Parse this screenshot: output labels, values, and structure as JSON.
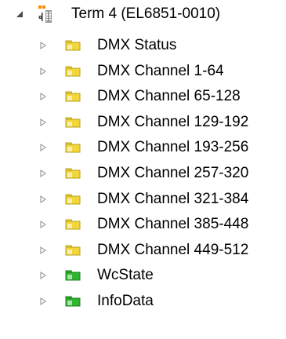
{
  "tree": {
    "root": {
      "label": "Term 4 (EL6851-0010)",
      "icon": "terminal-module-icon",
      "expanded": true
    },
    "children": [
      {
        "label": "DMX Status",
        "icon": "yellow-folder-icon",
        "color": "#f2d63a"
      },
      {
        "label": "DMX Channel 1-64",
        "icon": "yellow-folder-icon",
        "color": "#f2d63a"
      },
      {
        "label": "DMX Channel 65-128",
        "icon": "yellow-folder-icon",
        "color": "#f2d63a"
      },
      {
        "label": "DMX Channel 129-192",
        "icon": "yellow-folder-icon",
        "color": "#f2d63a"
      },
      {
        "label": "DMX Channel 193-256",
        "icon": "yellow-folder-icon",
        "color": "#f2d63a"
      },
      {
        "label": "DMX Channel 257-320",
        "icon": "yellow-folder-icon",
        "color": "#f2d63a"
      },
      {
        "label": "DMX Channel 321-384",
        "icon": "yellow-folder-icon",
        "color": "#f2d63a"
      },
      {
        "label": "DMX Channel 385-448",
        "icon": "yellow-folder-icon",
        "color": "#f2d63a"
      },
      {
        "label": "DMX Channel 449-512",
        "icon": "yellow-folder-icon",
        "color": "#f2d63a"
      },
      {
        "label": "WcState",
        "icon": "green-folder-icon",
        "color": "#2fb52f"
      },
      {
        "label": "InfoData",
        "icon": "green-folder-icon",
        "color": "#2fb52f"
      }
    ]
  }
}
